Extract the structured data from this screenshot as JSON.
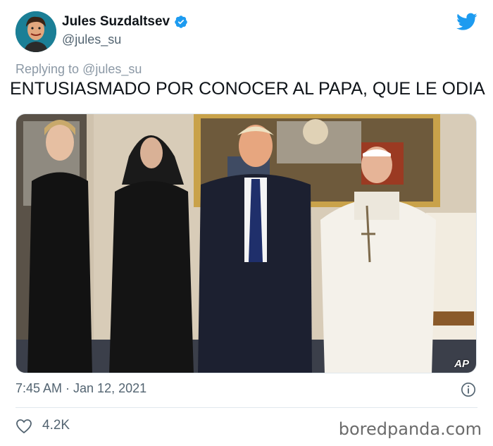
{
  "author": {
    "display_name": "Jules Suzdaltsev",
    "handle": "@jules_su",
    "verified": true,
    "avatar_icon": "user-avatar"
  },
  "reply_context": {
    "prefix": "Replying to",
    "handle": "@jules_su"
  },
  "tweet": {
    "text": "ENTUSIASMADO POR CONOCER AL PAPA, QUE LE ODIA",
    "photo_credit": "AP",
    "timestamp": "7:45 AM · Jan 12, 2021"
  },
  "engagement": {
    "likes": "4.2K"
  },
  "watermark": "boredpanda.com",
  "colors": {
    "twitter_blue": "#1d9bf0",
    "muted_text": "#536471",
    "text": "#0f1419"
  },
  "icons": [
    "verified-badge-icon",
    "twitter-bird-icon",
    "info-icon",
    "heart-icon"
  ]
}
